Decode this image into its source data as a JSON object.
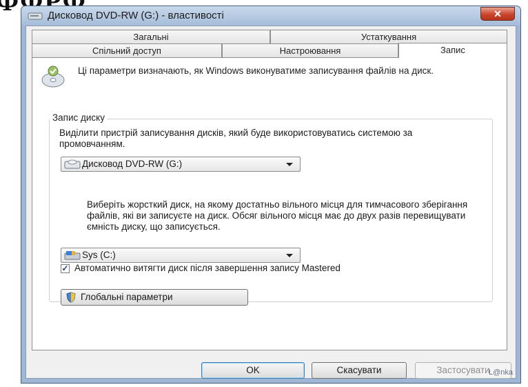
{
  "window": {
    "title": "Дисковод DVD-RW (G:) - властивості",
    "close_label": "✕"
  },
  "tabs_row1": [
    "Загальні",
    "Устаткування"
  ],
  "tabs_row2": [
    "Спільний доступ",
    "Настроювання",
    "Запис"
  ],
  "intro_text": "Ці параметри визначають, як Windows виконуватиме записування файлів на диск.",
  "burn_group": {
    "title": "Запис диску",
    "description": "Виділити пристрій записування дисків, який буде використовуватись системою за промовчанням.",
    "recorder_select": "Дисковод DVD-RW (G:)",
    "temp_description": "Виберіть жорсткий диск, на якому достатньо вільного місця для тимчасового зберігання файлів, які ви записуєте на диск. Обсяг вільного місця має до двух разів перевищувати ємність диску, що записується.",
    "drive_select": "Sys (C:)",
    "eject_checkbox": {
      "label": "Автоматично витягти диск після завершення запису Mastered",
      "checked": true
    },
    "global_button": "Глобальні параметри"
  },
  "buttons": {
    "ok": "OK",
    "cancel": "Скасувати",
    "apply": "Застосувати"
  },
  "watermark": "L@nka"
}
